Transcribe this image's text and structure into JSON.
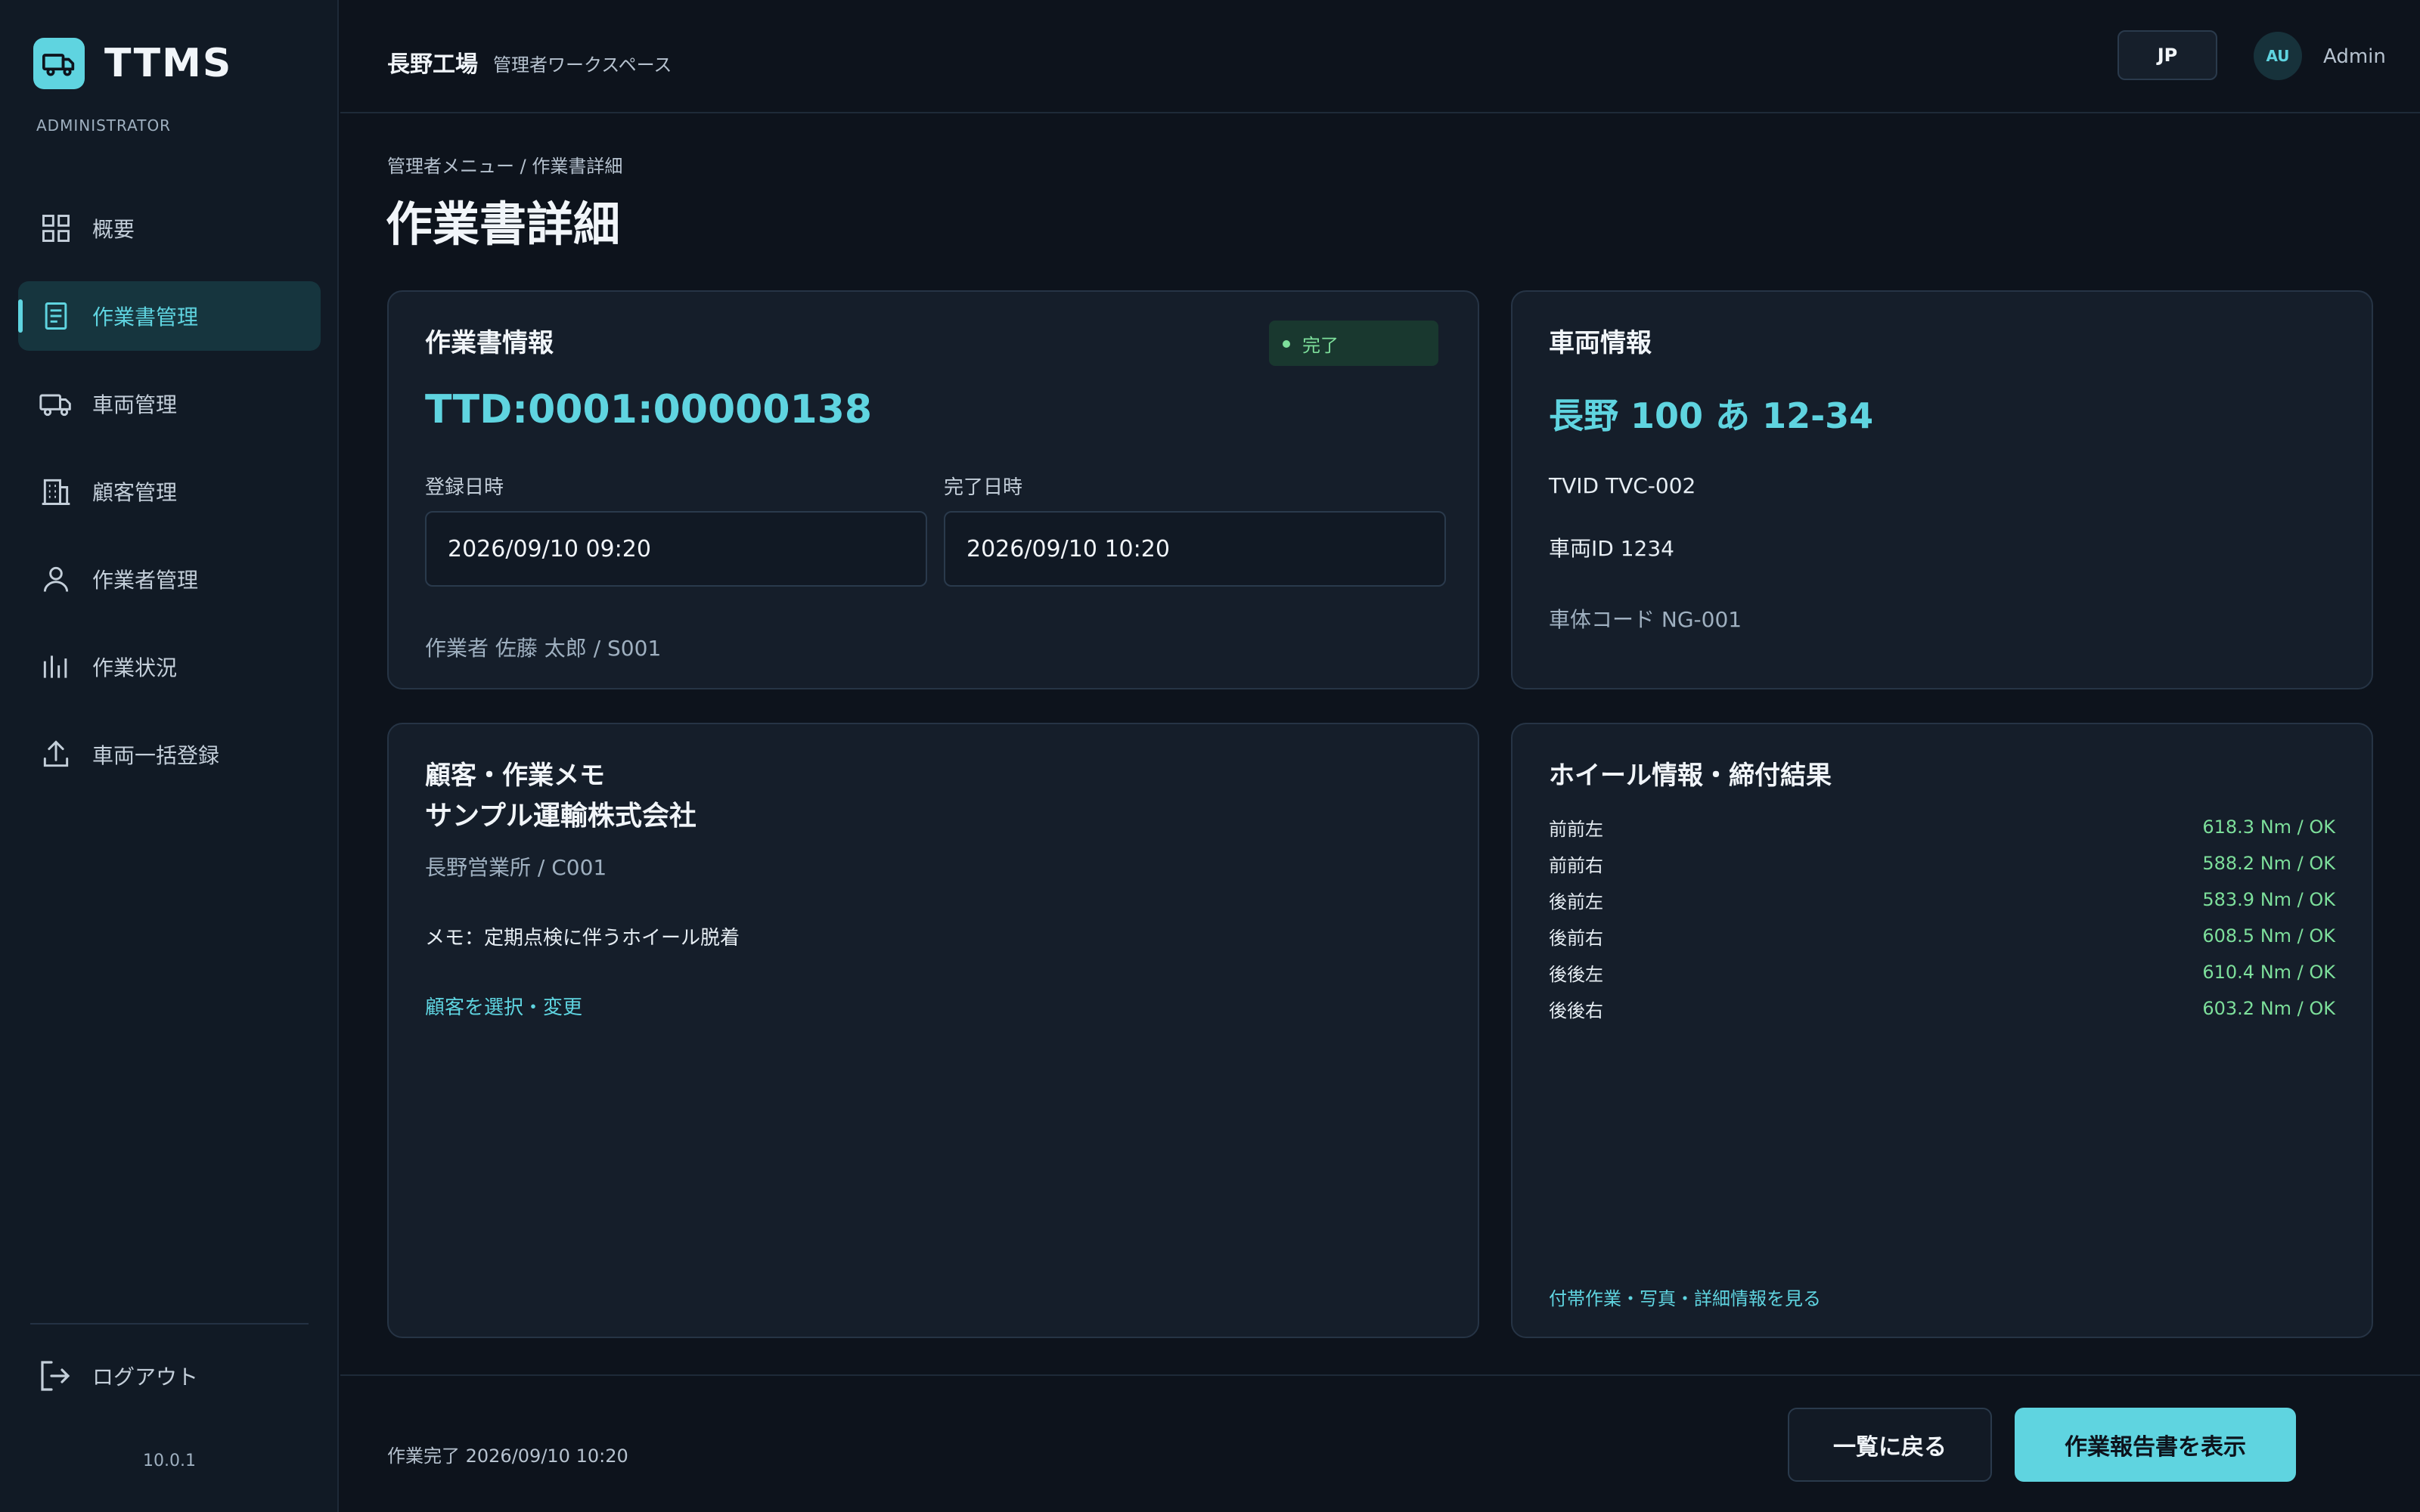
{
  "app": {
    "name": "TTMS",
    "role": "ADMINISTRATOR",
    "version": "10.0.1",
    "accent": "#5fd4e0",
    "success": "#7ddf9b"
  },
  "sidebar": {
    "items": [
      {
        "label": "概要",
        "icon": "grid-icon"
      },
      {
        "label": "作業書管理",
        "icon": "document-icon",
        "active": true
      },
      {
        "label": "車両管理",
        "icon": "truck-icon"
      },
      {
        "label": "顧客管理",
        "icon": "building-icon"
      },
      {
        "label": "作業者管理",
        "icon": "user-icon"
      },
      {
        "label": "作業状況",
        "icon": "bar-chart-icon"
      },
      {
        "label": "車両一括登録",
        "icon": "upload-icon"
      }
    ],
    "logout": "ログアウト"
  },
  "topbar": {
    "factory": "長野工場",
    "workspace": "管理者ワークスペース",
    "lang": "JP",
    "avatar": "AU",
    "user": "Admin"
  },
  "page": {
    "breadcrumb": "管理者メニュー / 作業書詳細",
    "title": "作業書詳細"
  },
  "work_order": {
    "title": "作業書情報",
    "status": "完了",
    "id": "TTD:0001:00000138",
    "registered_label": "登録日時",
    "registered_value": "2026/09/10 09:20",
    "completed_label": "完了日時",
    "completed_value": "2026/09/10 10:20",
    "worker": "作業者 佐藤 太郎 / S001"
  },
  "vehicle": {
    "title": "車両情報",
    "plate": "長野 100 あ 12-34",
    "tvid": "TVID TVC-002",
    "vehicle_id": "車両ID 1234",
    "body_code": "車体コード NG-001"
  },
  "customer": {
    "title": "顧客・作業メモ",
    "name": "サンプル運輸株式会社",
    "branch": "長野営業所 / C001",
    "memo": "メモ：定期点検に伴うホイール脱着",
    "change_link": "顧客を選択・変更"
  },
  "wheels": {
    "title": "ホイール情報・締付結果",
    "rows": [
      {
        "position": "前前左",
        "result": "618.3 Nm / OK"
      },
      {
        "position": "前前右",
        "result": "588.2 Nm / OK"
      },
      {
        "position": "後前左",
        "result": "583.9 Nm / OK"
      },
      {
        "position": "後前右",
        "result": "608.5 Nm / OK"
      },
      {
        "position": "後後左",
        "result": "610.4 Nm / OK"
      },
      {
        "position": "後後右",
        "result": "603.2 Nm / OK"
      }
    ],
    "details_link": "付帯作業・写真・詳細情報を見る"
  },
  "footer": {
    "status": "作業完了 2026/09/10 10:20",
    "back_label": "一覧に戻る",
    "report_label": "作業報告書を表示"
  }
}
